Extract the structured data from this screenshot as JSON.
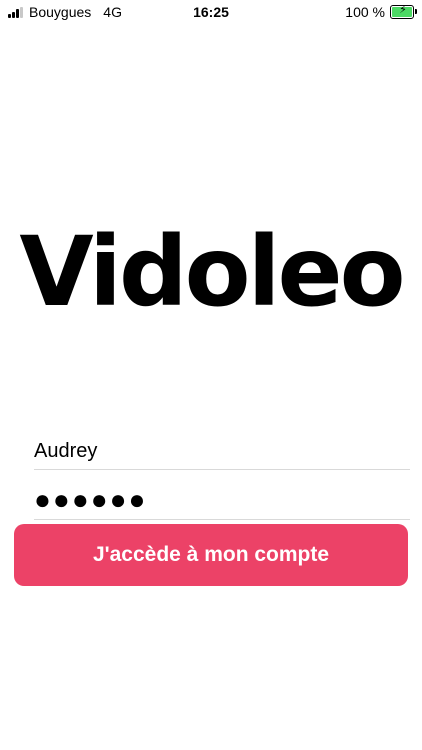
{
  "status_bar": {
    "carrier": "Bouygues",
    "network": "4G",
    "time": "16:25",
    "battery_percent": "100 %",
    "battery_color": "#4cd964"
  },
  "logo": {
    "text": "Vidoleo"
  },
  "form": {
    "username_value": "Audrey",
    "password_display": "●●●●●●",
    "submit_label": "J'accède à mon compte",
    "accent_color": "#ec4267"
  }
}
